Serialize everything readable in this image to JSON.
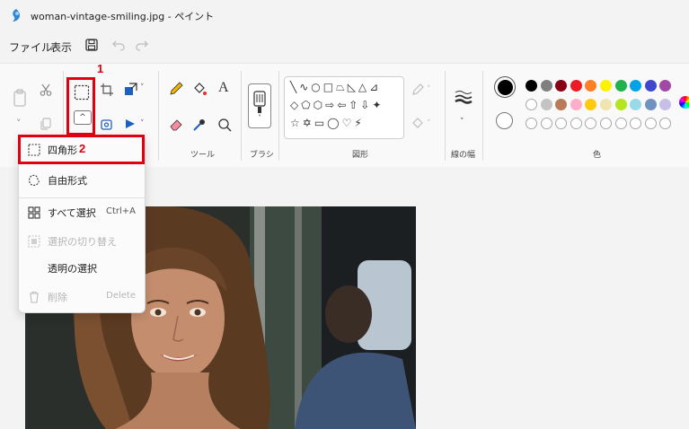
{
  "window": {
    "title": "woman-vintage-smiling.jpg - ペイント"
  },
  "menu": {
    "file": "ファイル",
    "view": "表示"
  },
  "groups": {
    "tools": "ツール",
    "brushes": "ブラシ",
    "shapes": "図形",
    "stroke": "線の幅",
    "colors": "色"
  },
  "annotations": {
    "first": "1",
    "second": "2"
  },
  "select_menu": {
    "items": [
      {
        "label": "四角形",
        "icon": "rectangle-select-icon"
      },
      {
        "label": "自由形式",
        "icon": "freeform-select-icon"
      },
      {
        "label": "すべて選択",
        "shortcut": "Ctrl+A",
        "icon": "select-all-icon"
      },
      {
        "label": "選択の切り替え",
        "icon": "invert-selection-icon",
        "disabled": true
      },
      {
        "label": "透明の選択",
        "icon": ""
      },
      {
        "label": "削除",
        "shortcut": "Delete",
        "icon": "trash-icon",
        "disabled": true
      }
    ]
  },
  "palette": {
    "row1": [
      "#000000",
      "#7f7f7f",
      "#880015",
      "#ed1c24",
      "#ff7f27",
      "#fff200",
      "#22b14c",
      "#00a2e8",
      "#3f48cc",
      "#a349a4"
    ],
    "row2": [
      "#ffffff",
      "#c3c3c3",
      "#b97a57",
      "#ffaec9",
      "#ffc90e",
      "#efe4b0",
      "#b5e61d",
      "#99d9ea",
      "#7092be",
      "#c8bfe7"
    ],
    "row3": [
      "#ffffff",
      "#ffffff",
      "#ffffff",
      "#ffffff",
      "#ffffff",
      "#ffffff",
      "#ffffff",
      "#ffffff",
      "#ffffff",
      "#ffffff"
    ]
  },
  "image": {
    "description_icon": "photo-canvas"
  }
}
